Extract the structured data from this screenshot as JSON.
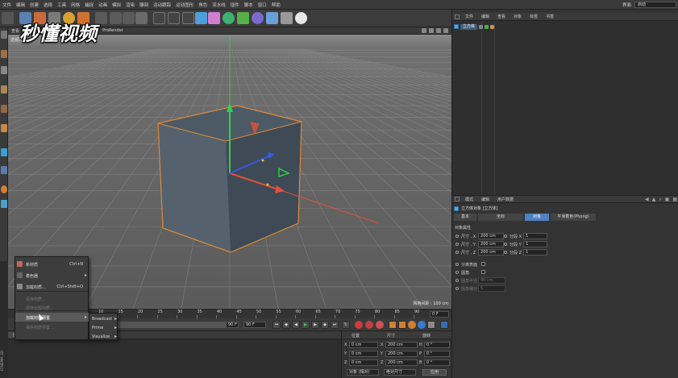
{
  "menubar": {
    "items": [
      "文件",
      "编辑",
      "创建",
      "选择",
      "工具",
      "网格",
      "捕捉",
      "动画",
      "模拟",
      "渲染",
      "雕刻",
      "运动跟踪",
      "运动图形",
      "角色",
      "流水线",
      "插件",
      "脚本",
      "窗口",
      "帮助"
    ],
    "layout_label": "界面",
    "layout_value": "启动"
  },
  "watermark": {
    "text": "秒懂视频"
  },
  "viewport": {
    "menu": [
      "查看",
      "摄像机",
      "显示",
      "选项",
      "过滤",
      "面板",
      "ProRender"
    ],
    "camera_label": "透视视图",
    "grid_scale": "网格间距 : 100 cm"
  },
  "timeline": {
    "ticks": [
      "10",
      "15",
      "20",
      "25",
      "30",
      "35",
      "40",
      "45",
      "50",
      "55",
      "60",
      "65",
      "70",
      "75",
      "80",
      "85",
      "90"
    ],
    "end_frame": "0 F"
  },
  "transport": {
    "start_field": "0 F",
    "end_field_a": "90 F",
    "end_field_b": "90 F"
  },
  "material_tabs": [
    "创建",
    "编辑",
    "功能",
    "纹理"
  ],
  "context_menu": {
    "items": [
      {
        "label": "新材质",
        "shortcut": "Ctrl+N",
        "icon_color": "#c06a5a",
        "disabled": false
      },
      {
        "label": "着色器",
        "submenu": true,
        "icon_color": "#666666",
        "disabled": false
      },
      {
        "label": "加载材质...",
        "shortcut": "Ctrl+Shift+O",
        "icon_color": "#8a8a8a",
        "disabled": false
      },
      {
        "label": "另存材质...",
        "disabled": true
      },
      {
        "label": "另存全部材质...",
        "disabled": true
      },
      {
        "label": "加载材质预置",
        "submenu": true,
        "highlight": true
      },
      {
        "label": "保存材质预置...",
        "disabled": true
      }
    ]
  },
  "preset_submenu": {
    "items": [
      "Broadcast",
      "Prime",
      "Visualize"
    ]
  },
  "coordinates": {
    "headers": [
      "位置",
      "尺寸",
      "旋转"
    ],
    "rows": [
      {
        "axis": "X",
        "pos": "0 cm",
        "size_axis": "X",
        "size": "200 cm",
        "rot_axis": "H",
        "rot": "0 °"
      },
      {
        "axis": "Y",
        "pos": "0 cm",
        "size_axis": "Y",
        "size": "200 cm",
        "rot_axis": "P",
        "rot": "0 °"
      },
      {
        "axis": "Z",
        "pos": "0 cm",
        "size_axis": "Z",
        "size": "200 cm",
        "rot_axis": "B",
        "rot": "0 °"
      }
    ],
    "mode_select": "对象 (相对)",
    "size_select": "绝对尺寸",
    "apply": "应用"
  },
  "object_manager": {
    "tabs": [
      "文件",
      "编辑",
      "查看",
      "对象",
      "标签",
      "书签"
    ],
    "object_name": "立方体"
  },
  "attribute_manager": {
    "tabs": [
      "模式",
      "编辑",
      "用户数据"
    ],
    "title": "立方体对象 [立方体]",
    "sub_tabs": [
      "基本",
      "坐标",
      "对象",
      "平滑着色(Phong)"
    ],
    "section": "对象属性",
    "size_rows": [
      {
        "label": "尺寸 . X",
        "value": "200 cm",
        "seg_label": "分段 X",
        "seg": "1"
      },
      {
        "label": "尺寸 . Y",
        "value": "200 cm",
        "seg_label": "分段 Y",
        "seg": "1"
      },
      {
        "label": "尺寸 . Z",
        "value": "200 cm",
        "seg_label": "分段 Z",
        "seg": "1"
      }
    ],
    "separate_surfaces": "分离表面",
    "fillet": "圆角",
    "fillet_radius_label": "圆角半径",
    "fillet_radius": "40 cm",
    "fillet_subdiv_label": "圆角细分",
    "fillet_subdiv": "5"
  },
  "app_label": "CINEMA 4D",
  "colors": {
    "accent_blue": "#4f82c2",
    "cube_face": "#4a5866",
    "selection_orange": "#e08a3a",
    "axis_green": "#2fd24a",
    "axis_red": "#e0503a",
    "axis_blue": "#3a5ae0"
  }
}
